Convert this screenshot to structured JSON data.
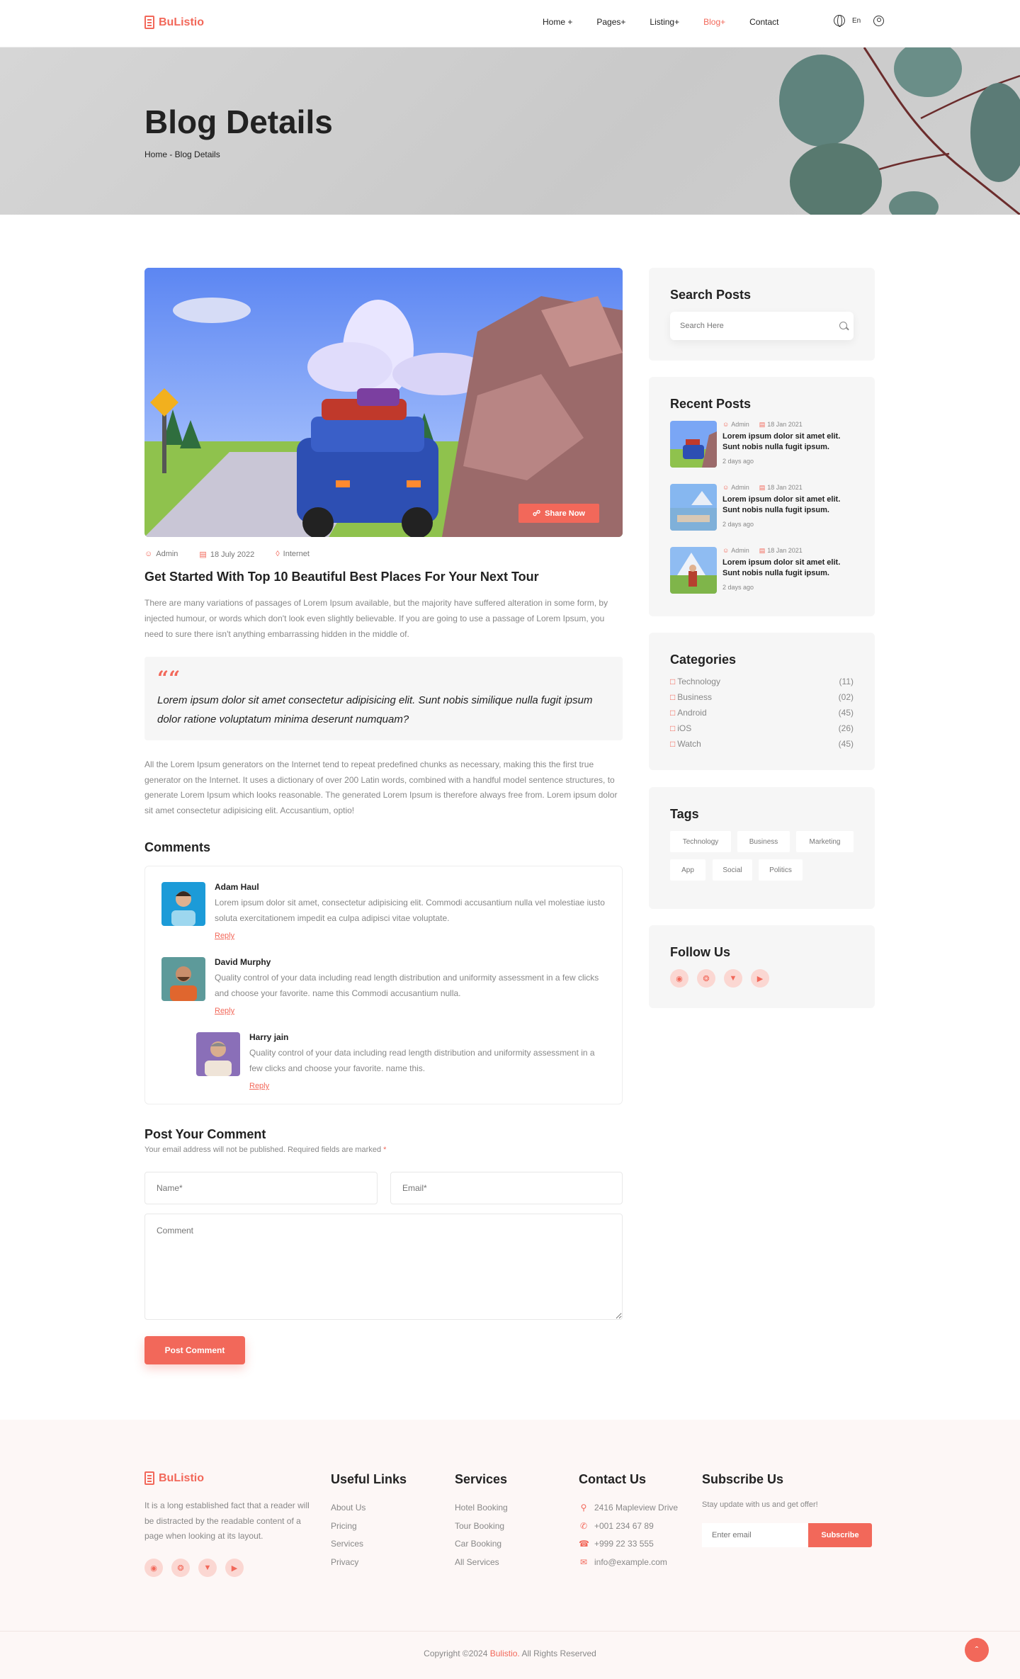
{
  "header": {
    "logo": "BuListio",
    "nav": [
      "Home +",
      "Pages+",
      "Listing+",
      "Blog+",
      "Contact"
    ],
    "lang": "En"
  },
  "hero": {
    "title": "Blog Details",
    "breadcrumb": "Home - Blog Details"
  },
  "post": {
    "share_label": "Share Now",
    "author": "Admin",
    "date": "18 July 2022",
    "category": "Internet",
    "title": "Get Started With Top 10 Beautiful Best Places For Your Next Tour",
    "para1": "There are many variations of passages of Lorem Ipsum available, but the majority have suffered alteration in some form, by injected humour, or words which don't look even slightly believable. If you are going to use a passage of Lorem Ipsum, you need to sure there isn't anything embarrassing hidden in the middle of.",
    "quote": "Lorem ipsum dolor sit amet consectetur adipisicing elit. Sunt nobis similique nulla fugit ipsum dolor ratione voluptatum minima deserunt numquam?",
    "para2": "All the Lorem Ipsum generators on the Internet tend to repeat predefined chunks as necessary, making this the first true generator on the Internet. It uses a dictionary of over 200 Latin words, combined with a handful model sentence structures, to generate Lorem Ipsum which looks reasonable. The generated Lorem Ipsum is therefore always free from. Lorem ipsum dolor sit amet consectetur adipisicing elit. Accusantium, optio!"
  },
  "comments": {
    "heading": "Comments",
    "reply_label": "Reply",
    "items": [
      {
        "name": "Adam Haul",
        "text": "Lorem ipsum dolor sit amet, consectetur adipisicing elit. Commodi accusantium nulla vel molestiae iusto soluta exercitationem impedit ea culpa adipisci vitae voluptate."
      },
      {
        "name": "David Murphy",
        "text": "Quality control of your data including read length distribution and uniformity assessment in a few clicks and choose your favorite. name this Commodi accusantium nulla."
      },
      {
        "name": "Harry jain",
        "text": "Quality control of your data including read length distribution and uniformity assessment in a few clicks and choose your favorite. name this."
      }
    ]
  },
  "form": {
    "heading": "Post Your Comment",
    "note": "Your email address will not be published. Required fields are marked",
    "required_mark": "*",
    "name_placeholder": "Name*",
    "email_placeholder": "Email*",
    "comment_placeholder": "Comment",
    "submit": "Post Comment"
  },
  "sidebar": {
    "search_heading": "Search Posts",
    "search_placeholder": "Search Here",
    "recent_heading": "Recent Posts",
    "recent": [
      {
        "author": "Admin",
        "date": "18 Jan 2021",
        "title": "Lorem ipsum dolor sit amet elit. Sunt nobis nulla fugit ipsum.",
        "ago": "2 days ago"
      },
      {
        "author": "Admin",
        "date": "18 Jan 2021",
        "title": "Lorem ipsum dolor sit amet elit. Sunt nobis nulla fugit ipsum.",
        "ago": "2 days ago"
      },
      {
        "author": "Admin",
        "date": "18 Jan 2021",
        "title": "Lorem ipsum dolor sit amet elit. Sunt nobis nulla fugit ipsum.",
        "ago": "2 days ago"
      }
    ],
    "categories_heading": "Categories",
    "categories": [
      {
        "name": "Technology",
        "count": "(11)"
      },
      {
        "name": "Business",
        "count": "(02)"
      },
      {
        "name": "Android",
        "count": "(45)"
      },
      {
        "name": "iOS",
        "count": "(26)"
      },
      {
        "name": "Watch",
        "count": "(45)"
      }
    ],
    "tags_heading": "Tags",
    "tags": [
      "Technology",
      "Business",
      "Marketing",
      "App",
      "Social",
      "Politics"
    ],
    "follow_heading": "Follow Us"
  },
  "footer": {
    "logo": "BuListio",
    "about": "It is a long established fact that a reader will be distracted by the readable content of a page when looking at its layout.",
    "useful_heading": "Useful Links",
    "useful": [
      "About Us",
      "Pricing",
      "Services",
      "Privacy"
    ],
    "services_heading": "Services",
    "services": [
      "Hotel Booking",
      "Tour Booking",
      "Car Booking",
      "All Services"
    ],
    "contact_heading": "Contact Us",
    "contact": [
      "2416 Mapleview Drive",
      "+001 234 67 89",
      "+999 22 33 555",
      "info@example.com"
    ],
    "subscribe_heading": "Subscribe Us",
    "subscribe_text": "Stay update with us and get offer!",
    "subscribe_placeholder": "Enter email",
    "subscribe_btn": "Subscribe",
    "copy_prefix": "Copyright ©2024",
    "copy_brand": "Bulistio.",
    "copy_suffix": "All Rights Reserved"
  },
  "colors": {
    "accent": "#f2685a",
    "text": "#222222",
    "muted": "#888888",
    "card": "#f6f6f6"
  }
}
